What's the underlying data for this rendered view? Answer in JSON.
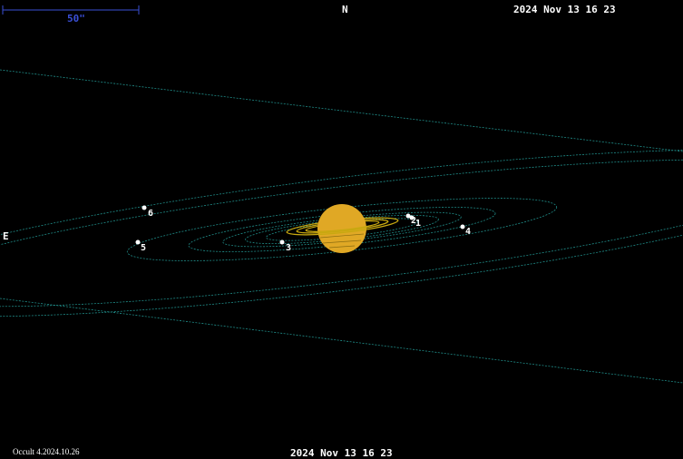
{
  "header": {
    "north_label": "N",
    "datetime_top": "2024 Nov 13 16 23"
  },
  "scale_bar": {
    "label": "50\""
  },
  "east_label": "E",
  "footer": {
    "program": "Occult 4.2024.10.26",
    "datetime_bottom": "2024 Nov 13 16 23"
  },
  "colors": {
    "background": "#000000",
    "orbit": "#1f8a86",
    "planet": "#e0a825",
    "rings": "#c8a810",
    "scale_bar": "#3a4fd6",
    "text": "#ffffff"
  },
  "moons": [
    {
      "id": "1",
      "label": "1"
    },
    {
      "id": "2",
      "label": "2"
    },
    {
      "id": "3",
      "label": "3"
    },
    {
      "id": "4",
      "label": "4"
    },
    {
      "id": "5",
      "label": "5"
    },
    {
      "id": "6",
      "label": "6"
    }
  ]
}
